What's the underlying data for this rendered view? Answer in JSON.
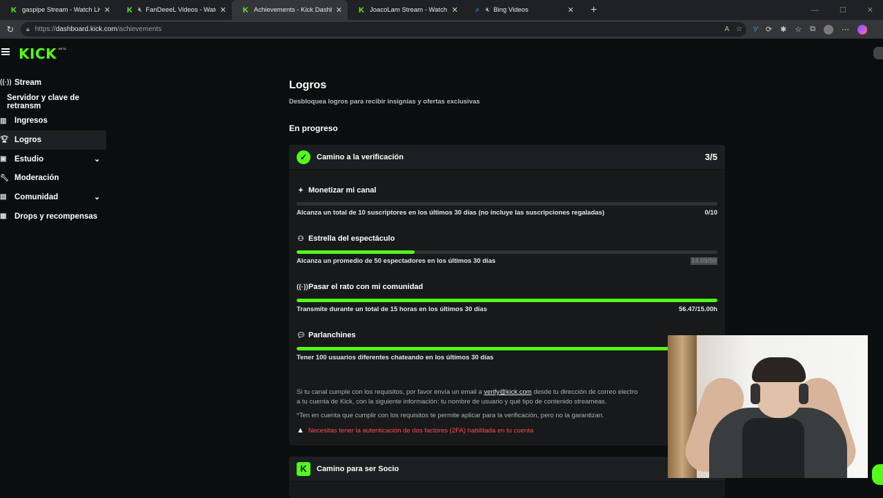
{
  "browser": {
    "tabs": [
      {
        "title": "gaspipe Stream - Watch Live on K",
        "icon": "kick-favicon",
        "active": false,
        "muted": false
      },
      {
        "title": "FanDeeeL Videos - Watch On",
        "icon": "kick-favicon",
        "active": false,
        "muted": true
      },
      {
        "title": "Achievements - Kick Dashboard",
        "icon": "kick-favicon",
        "active": true,
        "muted": false
      },
      {
        "title": "JoacoLam Stream - Watch Live on",
        "icon": "kick-favicon",
        "active": false,
        "muted": false
      },
      {
        "title": "Bing Videos",
        "icon": "search-favicon",
        "active": false,
        "muted": true
      }
    ],
    "url_scheme": "https://",
    "url_host": "dashboard.kick.com",
    "url_path": "/achievements"
  },
  "kick": {
    "logo": "KICK",
    "logo_tag": "BETA",
    "brand_color": "#53fc18"
  },
  "sidebar": {
    "items": [
      {
        "label": "Stream",
        "icon": "broadcast-icon"
      },
      {
        "label": "Servidor y clave de retransm",
        "icon": ""
      },
      {
        "label": "Ingresos",
        "icon": "chart-icon"
      },
      {
        "label": "Logros",
        "icon": "trophy-icon",
        "active": true
      },
      {
        "label": "Estudio",
        "icon": "studio-icon",
        "expandable": true
      },
      {
        "label": "Moderación",
        "icon": "wrench-icon"
      },
      {
        "label": "Comunidad",
        "icon": "community-icon",
        "expandable": true
      },
      {
        "label": "Drops y recompensas",
        "icon": "gift-icon"
      }
    ]
  },
  "main": {
    "title": "Logros",
    "subtitle": "Desbloquea logros para recibir insignias y ofertas exclusivas",
    "section_title": "En progreso",
    "card": {
      "title": "Camino a la verificación",
      "count": "3/5",
      "tasks": [
        {
          "name": "Monetizar mi canal",
          "icon": "sparkle-icon",
          "desc": "Alcanza un total de 10 suscriptores en los últimos 30 días (no incluye las suscripciones regaladas)",
          "value": "0/10",
          "progress": 0.0
        },
        {
          "name": "Estrella del espectáculo",
          "icon": "people-icon",
          "desc": "Alcanza un promedio de 50 espectadores en los últimos 30 días",
          "value": "14.09/50",
          "progress": 0.28
        },
        {
          "name": "Pasar el rato con mi comunidad",
          "icon": "broadcast-icon",
          "desc": "Transmite durante un total de 15 horas en los últimos 30 días",
          "value": "56.47/15.00h",
          "progress": 1.0
        },
        {
          "name": "Parlanchines",
          "icon": "chat-icon",
          "desc": "Tener 100 usuarios diferentes chateando en los últimos 30 días",
          "value": "",
          "progress": 1.0
        }
      ],
      "note_part1": "Si tu canal cumple con los requisitos, por favor envía un email a",
      "note_email": "verify@kick.com",
      "note_part2": "desde tu dirección de correo electro",
      "note_line2": "a tu cuenta de Kick, con la siguiente información: tu nombre de usuario y qué tipo de contenido streameas.",
      "note_line3": "*Ten en cuenta que cumplir con los requisitos te permite aplicar para la verificación, pero no la garantizan.",
      "warning": "Necesitas tener la autenticación de dos factores (2FA) habilitada en tu cuenta",
      "warning_color": "#ff4c4c"
    },
    "card2": {
      "title": "Camino para ser Socio"
    }
  }
}
